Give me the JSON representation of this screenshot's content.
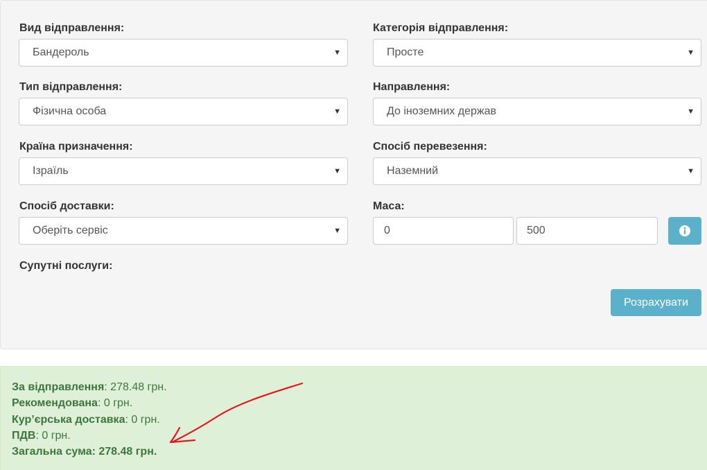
{
  "form": {
    "shipment_type": {
      "label": "Вид відправлення:",
      "value": "Бандероль"
    },
    "shipment_category": {
      "label": "Категорія відправлення:",
      "value": "Просте"
    },
    "sender_type": {
      "label": "Тип відправлення:",
      "value": "Фізична особа"
    },
    "direction": {
      "label": "Направлення:",
      "value": "До іноземних держав"
    },
    "destination_country": {
      "label": "Країна призначення:",
      "value": "Ізраїль"
    },
    "transport_method": {
      "label": "Спосіб перевезення:",
      "value": "Наземний"
    },
    "delivery_method": {
      "label": "Спосіб доставки:",
      "value": "Оберіть сервіс"
    },
    "weight": {
      "label": "Маса:",
      "kg_value": "0",
      "g_value": "500"
    },
    "extra_services": {
      "label": "Супутні послуги:"
    },
    "calculate_label": "Розрахувати",
    "info_icon": "info-circle-icon",
    "dropdown_icon": "caret-down-icon"
  },
  "result": {
    "shipping": {
      "label": "За відправлення",
      "value": ": 278.48 грн."
    },
    "registered": {
      "label": "Рекомендована",
      "value": ": 0 грн."
    },
    "courier": {
      "label": "Кур’єрська доставка",
      "value": ": 0 грн."
    },
    "vat": {
      "label": "ПДВ",
      "value": ": 0 грн."
    },
    "total": {
      "label": "Загальна сума",
      "value": ": 278.48 грн."
    }
  },
  "colors": {
    "accent": "#5bb1c9",
    "result_bg": "#dff0d8",
    "result_text": "#3c763d",
    "annotation": "#e8141c"
  }
}
